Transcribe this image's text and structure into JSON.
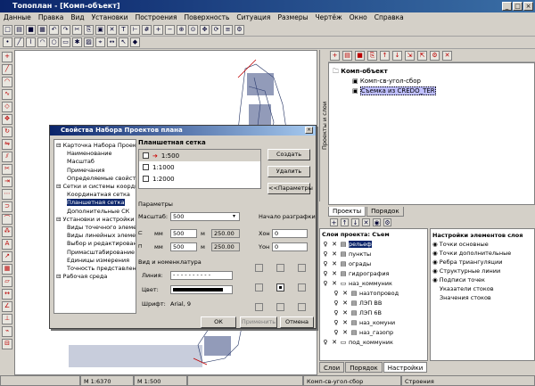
{
  "window": {
    "title": "Топоплан - [Комп-объект]"
  },
  "menu": [
    "Данные",
    "Правка",
    "Вид",
    "Установки",
    "Построения",
    "Поверхность",
    "Ситуация",
    "Размеры",
    "Чертёж",
    "Окно",
    "Справка"
  ],
  "right_panel": {
    "vertical_tab": "Проекты и слои",
    "tree": {
      "root": "Комп-объект",
      "items": [
        "Комп-св-угол-сбор",
        "Съемка из CREDO_TER"
      ]
    },
    "tabs": [
      "Проекты",
      "Порядок"
    ],
    "layers_header": "Слои проекта: Съем",
    "layers": [
      "рельеф",
      "пункты",
      "ограды",
      "гидрография",
      "наз_коммуник",
      "назтопровод",
      "ЛЭП ВВ",
      "ЛЭП 6В",
      "наз_комуни",
      "наз_газопр",
      "под_коммуник"
    ],
    "props_header": "Настройки элементов слоя",
    "props": [
      "Точки основные",
      "Точки дополнительные",
      "Ребра триангуляции",
      "Структурные линии",
      "Подписи точек",
      "Указатели стоков",
      "Значения стоков"
    ],
    "bottom_tabs": [
      "Слои",
      "Порядок",
      "Настройки"
    ]
  },
  "dialog": {
    "title": "Свойства Набора Проектов плана",
    "tree": [
      {
        "label": "Карточка Набора Проектов",
        "level": 0
      },
      {
        "label": "Наименование",
        "level": 1
      },
      {
        "label": "Масштаб",
        "level": 1
      },
      {
        "label": "Примечания",
        "level": 1
      },
      {
        "label": "Определяемые свойства",
        "level": 1
      },
      {
        "label": "Сетки и системы координат",
        "level": 0
      },
      {
        "label": "Координатная сетка",
        "level": 1
      },
      {
        "label": "Планшетная сетка",
        "level": 1,
        "selected": true
      },
      {
        "label": "Дополнительные СК",
        "level": 1
      },
      {
        "label": "Установки и настройки",
        "level": 0
      },
      {
        "label": "Виды точечного элемента",
        "level": 1
      },
      {
        "label": "Виды линейных элементов",
        "level": 1
      },
      {
        "label": "Выбор и редактирование",
        "level": 1
      },
      {
        "label": "Примасштабирование",
        "level": 1
      },
      {
        "label": "Единицы измерения",
        "level": 1
      },
      {
        "label": "Точность представления",
        "level": 1
      },
      {
        "label": "Рабочая среда",
        "level": 0
      }
    ],
    "section_title": "Планшетная сетка",
    "grid_items": [
      "1:500",
      "1:1000",
      "1:2000"
    ],
    "buttons": {
      "create": "Создать",
      "delete": "Удалить",
      "params": "<<Параметры"
    },
    "params_label": "Параметры",
    "scale_label": "Масштаб:",
    "scale_value": "500",
    "origin_label": "Начало разграфки",
    "rows": [
      {
        "label": "мм",
        "value": "500",
        "unit": "м",
        "calc": "250.00"
      },
      {
        "label": "мм",
        "value": "500",
        "unit": "м",
        "calc": "250.00"
      }
    ],
    "x0_label": "Хон",
    "x0_value": "0",
    "y0_label": "Yон",
    "y0_value": "0",
    "style_group": "Вид и номенклатура",
    "line_label": "Линия:",
    "color_label": "Цвет:",
    "font_label": "Шрифт:",
    "font_value": "Arial, 9",
    "ok": "ОК",
    "apply": "Применить",
    "cancel": "Отмена"
  },
  "status": {
    "scale1": "М 1:6370",
    "scale2": "М 1:500",
    "project": "Комп-св-угол-сбор",
    "layer": "Строения"
  }
}
